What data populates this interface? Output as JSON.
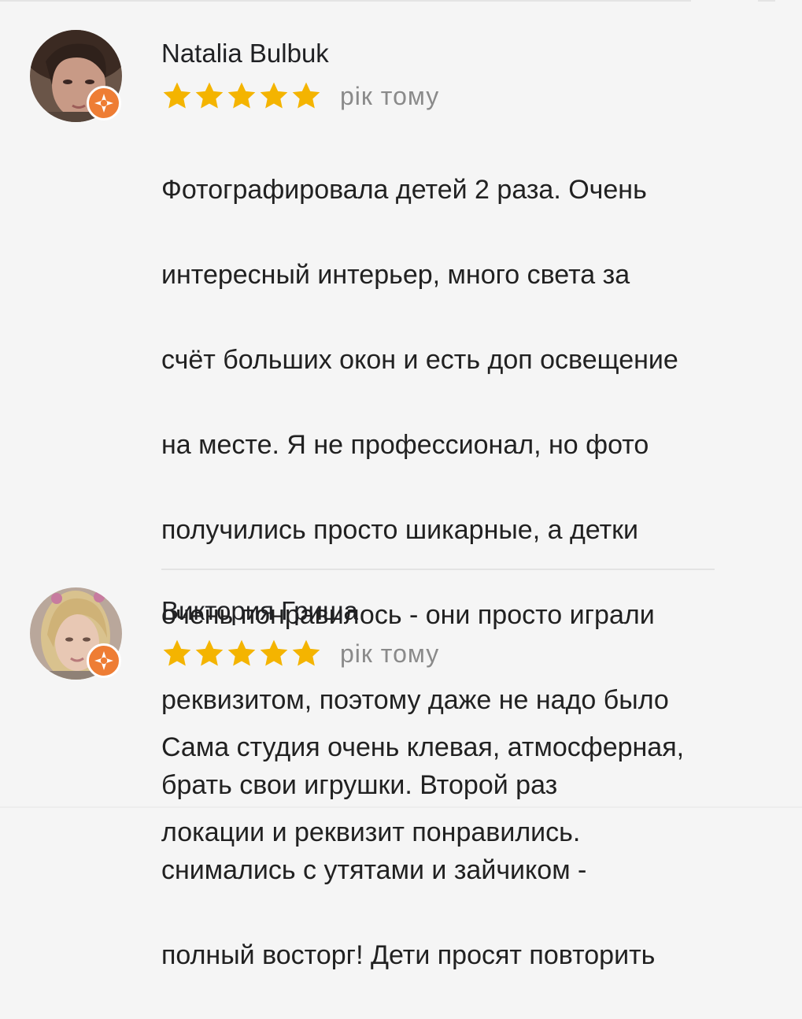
{
  "colors": {
    "background": "#f5f5f5",
    "star": "#f4b400",
    "badge": "#ee7d34",
    "time_text": "#8a8a8a",
    "divider": "#e3e3e3"
  },
  "reviews": [
    {
      "author": "Natalia Bulbuk",
      "rating": 5,
      "time": "рік тому",
      "lines": [
        "Фотографировала детей 2 раза. Очень",
        "интересный интерьер, много света за",
        "счёт больших окон и есть доп освещение",
        "на месте. Я не профессионал, но фото",
        "получились просто шикарные, а детки",
        "очень понравилось - они просто играли",
        "реквизитом, поэтому даже не надо было",
        "брать свои игрушки. Второй раз",
        "снимались с утятами и зайчиком -",
        "полный восторг! Дети просят повторить"
      ],
      "avatar_icon": "user-photo",
      "badge_icon": "local-guide-star-icon"
    },
    {
      "author": "Виктория Гриша",
      "rating": 5,
      "time": "рік тому",
      "lines": [
        "Сама студия очень клевая, атмосферная,",
        "локации и реквизит понравились."
      ],
      "avatar_icon": "user-photo",
      "badge_icon": "local-guide-star-icon"
    }
  ]
}
